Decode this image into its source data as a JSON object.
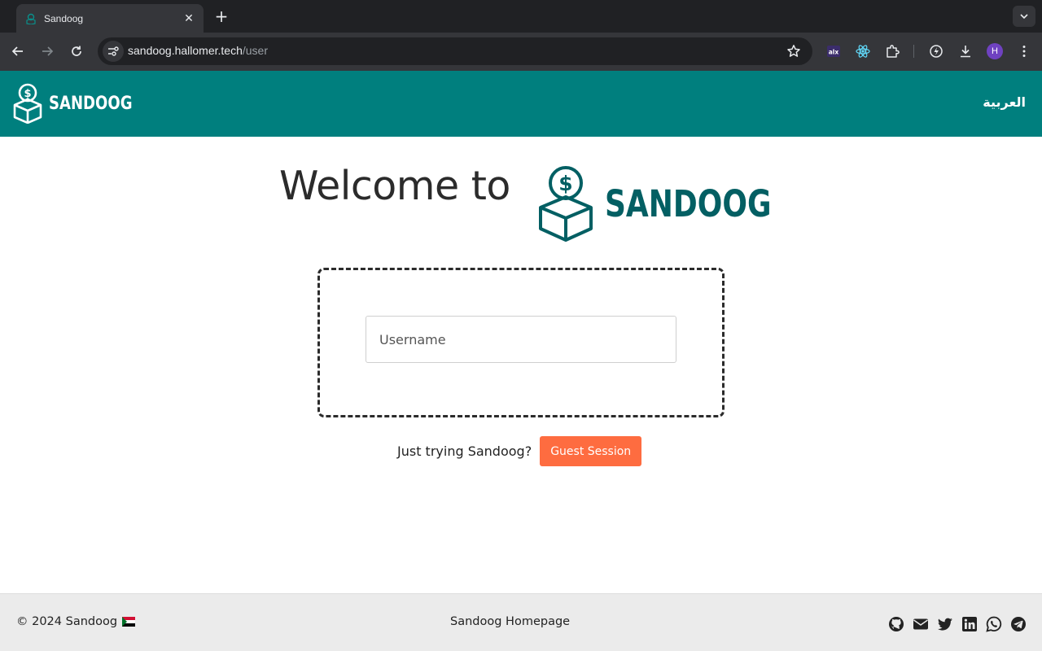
{
  "browser": {
    "tab_title": "Sandoog",
    "url_host": "sandoog.hallomer.tech",
    "url_path": "/user",
    "profile_initial": "H"
  },
  "header": {
    "logo_text": "SANDOOG",
    "lang_switch": "العربية"
  },
  "main": {
    "welcome_text": "Welcome to",
    "logo_text": "SANDOOG",
    "username_placeholder": "Username",
    "guest_prompt": "Just trying Sandoog?",
    "guest_button": "Guest Session"
  },
  "footer": {
    "copyright": "© 2024 Sandoog",
    "homepage_link": "Sandoog Homepage",
    "socials": [
      "github-icon",
      "email-icon",
      "twitter-icon",
      "linkedin-icon",
      "whatsapp-icon",
      "telegram-icon"
    ]
  },
  "colors": {
    "brand_teal": "#007f7e",
    "logo_dark_teal": "#035f63",
    "accent_orange": "#fe6c40",
    "footer_bg": "#ebebeb"
  }
}
